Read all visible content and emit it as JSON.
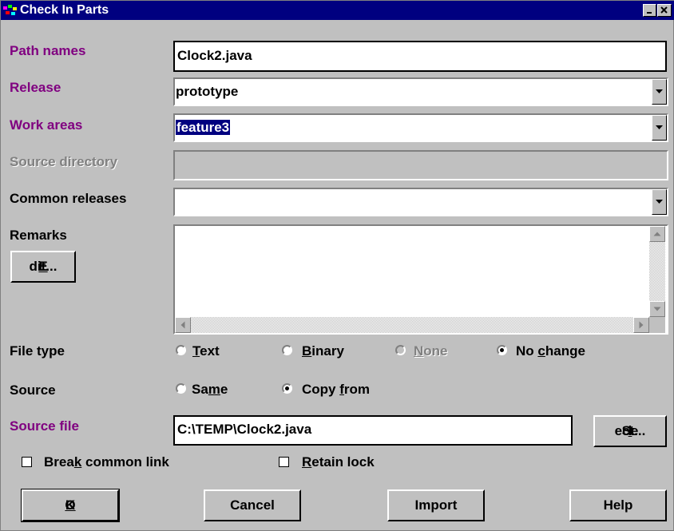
{
  "window": {
    "title": "Check In Parts"
  },
  "labels": {
    "path_names": "Path names",
    "release": "Release",
    "work_areas": "Work areas",
    "source_directory": "Source directory",
    "common_releases": "Common releases",
    "remarks": "Remarks",
    "file_type": "File type",
    "source": "Source",
    "source_file": "Source file"
  },
  "fields": {
    "path_names": "Clock2.java",
    "release": "prototype",
    "work_areas": "feature3",
    "source_directory": "",
    "common_releases": "",
    "remarks": "",
    "source_file": "C:\\TEMP\\Clock2.java"
  },
  "file_type_options": [
    {
      "pre": "",
      "u": "T",
      "post": "ext",
      "checked": false,
      "enabled": true
    },
    {
      "pre": "",
      "u": "B",
      "post": "inary",
      "checked": false,
      "enabled": true
    },
    {
      "pre": "",
      "u": "N",
      "post": "one",
      "checked": false,
      "enabled": false
    },
    {
      "pre": "No ",
      "u": "c",
      "post": "hange",
      "checked": true,
      "enabled": true
    }
  ],
  "source_options": [
    {
      "pre": "Sa",
      "u": "m",
      "post": "e",
      "checked": false
    },
    {
      "pre": "Copy ",
      "u": "f",
      "post": "rom",
      "checked": true
    }
  ],
  "buttons": {
    "edit": {
      "pre": "",
      "u": "E",
      "post": "dit..."
    },
    "select": {
      "pre": "Se",
      "u": "l",
      "post": "ect..."
    },
    "ok": {
      "pre": "",
      "u": "O",
      "post": "K"
    },
    "cancel": "Cancel",
    "import": "Import",
    "help": "Help"
  },
  "checkboxes": {
    "break_common_link": {
      "pre": "Brea",
      "u": "k",
      "post": " common link",
      "checked": false
    },
    "retain_lock": {
      "pre": "",
      "u": "R",
      "post": "etain lock",
      "checked": false
    }
  },
  "colors": {
    "title_bar": "#000080",
    "label_required": "#800080",
    "face": "#c0c0c0"
  }
}
